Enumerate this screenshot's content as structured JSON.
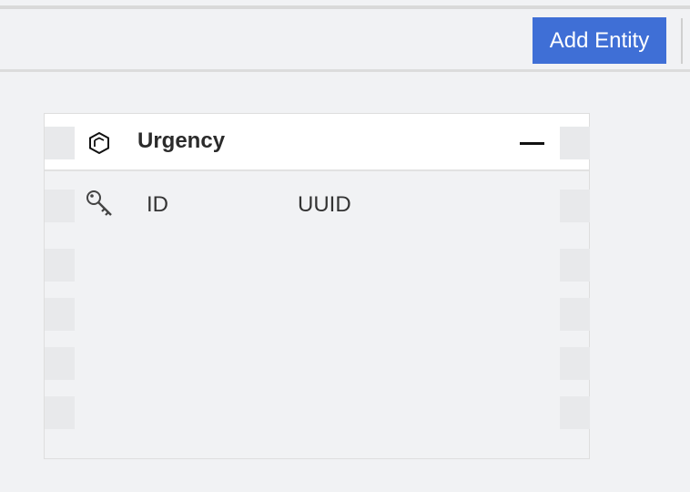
{
  "toolbar": {
    "add_entity_label": "Add Entity",
    "accent_color": "#3f6fd6"
  },
  "entity": {
    "title": "Urgency",
    "icon": "cube-icon",
    "collapse_icon": "minus-icon",
    "attributes": [
      {
        "name": "ID",
        "type": "UUID",
        "icon": "key-icon",
        "primary_key": true
      }
    ]
  }
}
